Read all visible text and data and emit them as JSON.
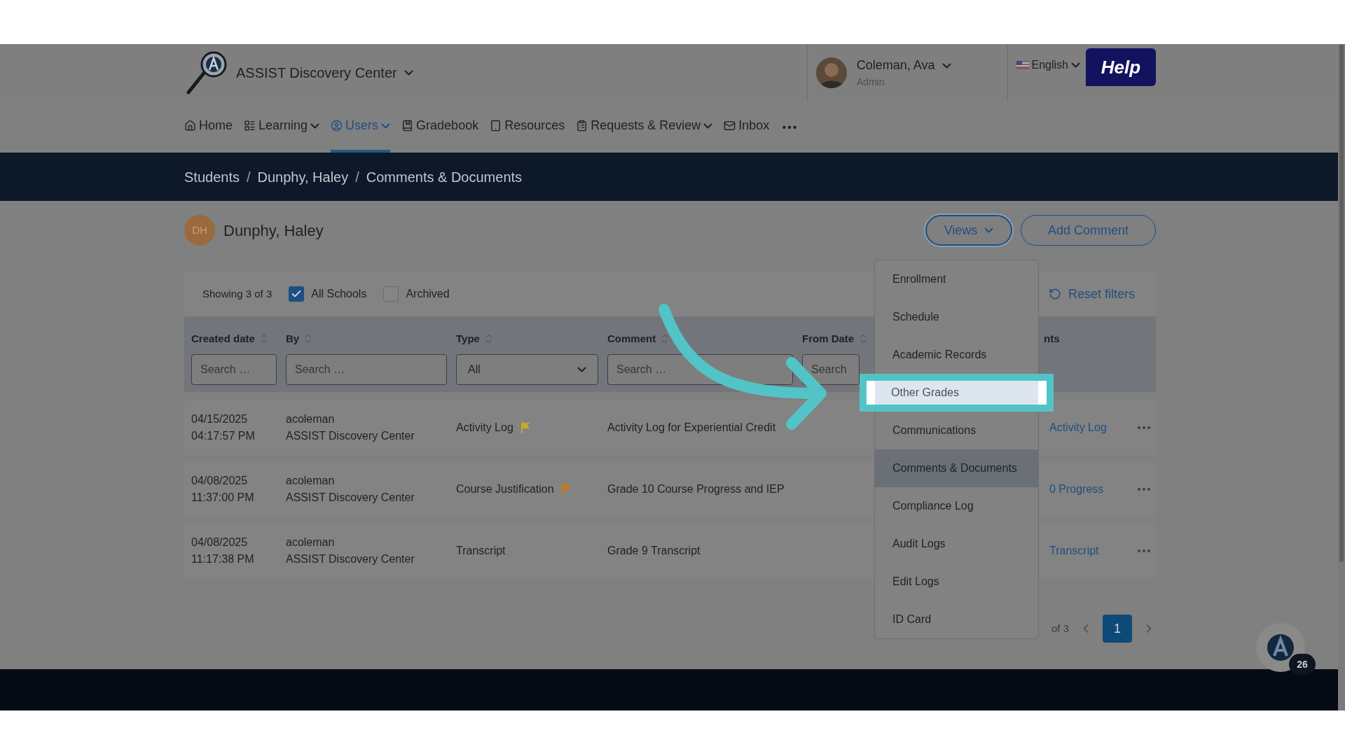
{
  "header": {
    "org": "ASSIST Discovery Center",
    "user_name": "Coleman, Ava",
    "user_role": "Admin",
    "language": "English",
    "help": "Help"
  },
  "nav": [
    {
      "label": "Home",
      "dropdown": false,
      "selected": false
    },
    {
      "label": "Learning",
      "dropdown": true,
      "selected": false
    },
    {
      "label": "Users",
      "dropdown": true,
      "selected": true
    },
    {
      "label": "Gradebook",
      "dropdown": false,
      "selected": false
    },
    {
      "label": "Resources",
      "dropdown": false,
      "selected": false
    },
    {
      "label": "Requests & Review",
      "dropdown": true,
      "selected": false
    },
    {
      "label": "Inbox",
      "dropdown": false,
      "selected": false
    }
  ],
  "breadcrumb": [
    {
      "kind": "link",
      "label": "Students"
    },
    {
      "kind": "separator",
      "label": "/"
    },
    {
      "kind": "link",
      "label": "Dunphy, Haley"
    },
    {
      "kind": "separator",
      "label": "/"
    },
    {
      "kind": "link",
      "label": "Comments & Documents"
    }
  ],
  "student": {
    "initials": "DH",
    "name": "Dunphy, Haley"
  },
  "buttons": {
    "views": "Views",
    "add_comment": "Add Comment"
  },
  "filters": {
    "showing": "Showing 3 of 3",
    "options": [
      {
        "label": "All Schools",
        "checked": true
      },
      {
        "label": "Archived",
        "checked": false
      }
    ],
    "reset": "Reset filters"
  },
  "table": {
    "columns": [
      {
        "label": "Created date",
        "placeholder": "Search …",
        "kind": "text"
      },
      {
        "label": "By",
        "placeholder": "Search …",
        "kind": "text"
      },
      {
        "label": "Type",
        "value": "All",
        "kind": "select"
      },
      {
        "label": "Comment",
        "placeholder": "Search …",
        "kind": "text"
      },
      {
        "label": "From Date",
        "placeholder": "Search",
        "kind": "text"
      }
    ],
    "column_6": "nts",
    "rows": [
      {
        "date": "04/15/2025",
        "time": "04:17:57 PM",
        "user": "acoleman",
        "org": "ASSIST Discovery Center",
        "type": "Activity Log",
        "color": "#c8a630",
        "comment": "Activity Log for Experiential Credit",
        "document": "Activity Log"
      },
      {
        "date": "04/08/2025",
        "time": "11:37:00 PM",
        "user": "acoleman",
        "org": "ASSIST Discovery Center",
        "type": "Course Justification",
        "color": "#c47a1c",
        "comment": "Grade 10 Course Progress and IEP",
        "document": "0 Progress"
      },
      {
        "date": "04/08/2025",
        "time": "11:17:38 PM",
        "user": "acoleman",
        "org": "ASSIST Discovery Center",
        "type": "Transcript",
        "comment": "Grade 9 Transcript",
        "document": "Transcript"
      }
    ]
  },
  "pagination": {
    "of": "of 3",
    "pages": [
      {
        "label": "1",
        "selected": true
      }
    ]
  },
  "views_menu": [
    {
      "label": "Enrollment",
      "selected": false,
      "highlighted": false
    },
    {
      "label": "Schedule",
      "selected": false,
      "highlighted": false
    },
    {
      "label": "Academic Records",
      "selected": false,
      "highlighted": false
    },
    {
      "label": "Other Grades",
      "selected": false,
      "highlighted": true
    },
    {
      "label": "Communications",
      "selected": false,
      "highlighted": false
    },
    {
      "label": "Comments & Documents",
      "selected": true,
      "highlighted": false
    },
    {
      "label": "Compliance Log",
      "selected": false,
      "highlighted": false
    },
    {
      "label": "Audit Logs",
      "selected": false,
      "highlighted": false
    },
    {
      "label": "Edit Logs",
      "selected": false,
      "highlighted": false
    },
    {
      "label": "ID Card",
      "selected": false,
      "highlighted": false
    }
  ],
  "chat": {
    "badge": "26"
  }
}
